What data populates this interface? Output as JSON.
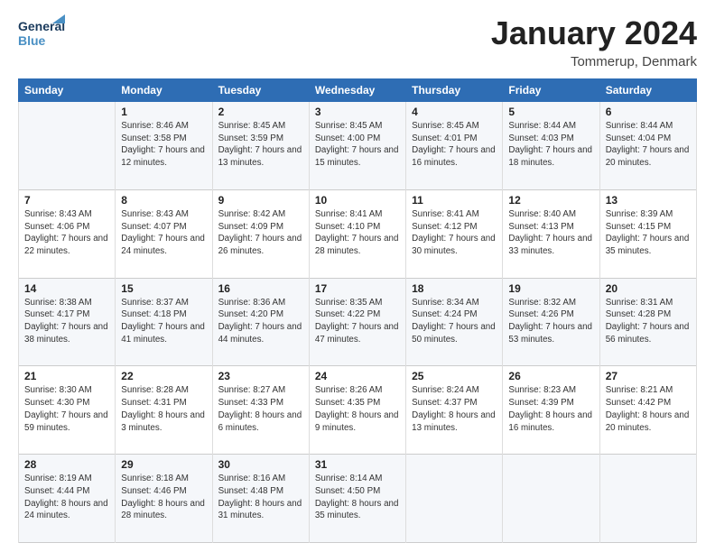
{
  "logo": {
    "line1": "General",
    "line2": "Blue"
  },
  "title": "January 2024",
  "subtitle": "Tommerup, Denmark",
  "days_header": [
    "Sunday",
    "Monday",
    "Tuesday",
    "Wednesday",
    "Thursday",
    "Friday",
    "Saturday"
  ],
  "weeks": [
    [
      {
        "num": "",
        "sunrise": "",
        "sunset": "",
        "daylight": ""
      },
      {
        "num": "1",
        "sunrise": "Sunrise: 8:46 AM",
        "sunset": "Sunset: 3:58 PM",
        "daylight": "Daylight: 7 hours and 12 minutes."
      },
      {
        "num": "2",
        "sunrise": "Sunrise: 8:45 AM",
        "sunset": "Sunset: 3:59 PM",
        "daylight": "Daylight: 7 hours and 13 minutes."
      },
      {
        "num": "3",
        "sunrise": "Sunrise: 8:45 AM",
        "sunset": "Sunset: 4:00 PM",
        "daylight": "Daylight: 7 hours and 15 minutes."
      },
      {
        "num": "4",
        "sunrise": "Sunrise: 8:45 AM",
        "sunset": "Sunset: 4:01 PM",
        "daylight": "Daylight: 7 hours and 16 minutes."
      },
      {
        "num": "5",
        "sunrise": "Sunrise: 8:44 AM",
        "sunset": "Sunset: 4:03 PM",
        "daylight": "Daylight: 7 hours and 18 minutes."
      },
      {
        "num": "6",
        "sunrise": "Sunrise: 8:44 AM",
        "sunset": "Sunset: 4:04 PM",
        "daylight": "Daylight: 7 hours and 20 minutes."
      }
    ],
    [
      {
        "num": "7",
        "sunrise": "Sunrise: 8:43 AM",
        "sunset": "Sunset: 4:06 PM",
        "daylight": "Daylight: 7 hours and 22 minutes."
      },
      {
        "num": "8",
        "sunrise": "Sunrise: 8:43 AM",
        "sunset": "Sunset: 4:07 PM",
        "daylight": "Daylight: 7 hours and 24 minutes."
      },
      {
        "num": "9",
        "sunrise": "Sunrise: 8:42 AM",
        "sunset": "Sunset: 4:09 PM",
        "daylight": "Daylight: 7 hours and 26 minutes."
      },
      {
        "num": "10",
        "sunrise": "Sunrise: 8:41 AM",
        "sunset": "Sunset: 4:10 PM",
        "daylight": "Daylight: 7 hours and 28 minutes."
      },
      {
        "num": "11",
        "sunrise": "Sunrise: 8:41 AM",
        "sunset": "Sunset: 4:12 PM",
        "daylight": "Daylight: 7 hours and 30 minutes."
      },
      {
        "num": "12",
        "sunrise": "Sunrise: 8:40 AM",
        "sunset": "Sunset: 4:13 PM",
        "daylight": "Daylight: 7 hours and 33 minutes."
      },
      {
        "num": "13",
        "sunrise": "Sunrise: 8:39 AM",
        "sunset": "Sunset: 4:15 PM",
        "daylight": "Daylight: 7 hours and 35 minutes."
      }
    ],
    [
      {
        "num": "14",
        "sunrise": "Sunrise: 8:38 AM",
        "sunset": "Sunset: 4:17 PM",
        "daylight": "Daylight: 7 hours and 38 minutes."
      },
      {
        "num": "15",
        "sunrise": "Sunrise: 8:37 AM",
        "sunset": "Sunset: 4:18 PM",
        "daylight": "Daylight: 7 hours and 41 minutes."
      },
      {
        "num": "16",
        "sunrise": "Sunrise: 8:36 AM",
        "sunset": "Sunset: 4:20 PM",
        "daylight": "Daylight: 7 hours and 44 minutes."
      },
      {
        "num": "17",
        "sunrise": "Sunrise: 8:35 AM",
        "sunset": "Sunset: 4:22 PM",
        "daylight": "Daylight: 7 hours and 47 minutes."
      },
      {
        "num": "18",
        "sunrise": "Sunrise: 8:34 AM",
        "sunset": "Sunset: 4:24 PM",
        "daylight": "Daylight: 7 hours and 50 minutes."
      },
      {
        "num": "19",
        "sunrise": "Sunrise: 8:32 AM",
        "sunset": "Sunset: 4:26 PM",
        "daylight": "Daylight: 7 hours and 53 minutes."
      },
      {
        "num": "20",
        "sunrise": "Sunrise: 8:31 AM",
        "sunset": "Sunset: 4:28 PM",
        "daylight": "Daylight: 7 hours and 56 minutes."
      }
    ],
    [
      {
        "num": "21",
        "sunrise": "Sunrise: 8:30 AM",
        "sunset": "Sunset: 4:30 PM",
        "daylight": "Daylight: 7 hours and 59 minutes."
      },
      {
        "num": "22",
        "sunrise": "Sunrise: 8:28 AM",
        "sunset": "Sunset: 4:31 PM",
        "daylight": "Daylight: 8 hours and 3 minutes."
      },
      {
        "num": "23",
        "sunrise": "Sunrise: 8:27 AM",
        "sunset": "Sunset: 4:33 PM",
        "daylight": "Daylight: 8 hours and 6 minutes."
      },
      {
        "num": "24",
        "sunrise": "Sunrise: 8:26 AM",
        "sunset": "Sunset: 4:35 PM",
        "daylight": "Daylight: 8 hours and 9 minutes."
      },
      {
        "num": "25",
        "sunrise": "Sunrise: 8:24 AM",
        "sunset": "Sunset: 4:37 PM",
        "daylight": "Daylight: 8 hours and 13 minutes."
      },
      {
        "num": "26",
        "sunrise": "Sunrise: 8:23 AM",
        "sunset": "Sunset: 4:39 PM",
        "daylight": "Daylight: 8 hours and 16 minutes."
      },
      {
        "num": "27",
        "sunrise": "Sunrise: 8:21 AM",
        "sunset": "Sunset: 4:42 PM",
        "daylight": "Daylight: 8 hours and 20 minutes."
      }
    ],
    [
      {
        "num": "28",
        "sunrise": "Sunrise: 8:19 AM",
        "sunset": "Sunset: 4:44 PM",
        "daylight": "Daylight: 8 hours and 24 minutes."
      },
      {
        "num": "29",
        "sunrise": "Sunrise: 8:18 AM",
        "sunset": "Sunset: 4:46 PM",
        "daylight": "Daylight: 8 hours and 28 minutes."
      },
      {
        "num": "30",
        "sunrise": "Sunrise: 8:16 AM",
        "sunset": "Sunset: 4:48 PM",
        "daylight": "Daylight: 8 hours and 31 minutes."
      },
      {
        "num": "31",
        "sunrise": "Sunrise: 8:14 AM",
        "sunset": "Sunset: 4:50 PM",
        "daylight": "Daylight: 8 hours and 35 minutes."
      },
      {
        "num": "",
        "sunrise": "",
        "sunset": "",
        "daylight": ""
      },
      {
        "num": "",
        "sunrise": "",
        "sunset": "",
        "daylight": ""
      },
      {
        "num": "",
        "sunrise": "",
        "sunset": "",
        "daylight": ""
      }
    ]
  ]
}
